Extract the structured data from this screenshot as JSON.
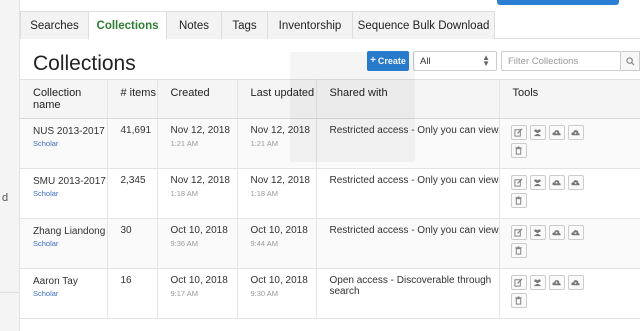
{
  "left_fragment": "d",
  "tabs": [
    {
      "label": "Searches",
      "active": false
    },
    {
      "label": "Collections",
      "active": true
    },
    {
      "label": "Notes",
      "active": false
    },
    {
      "label": "Tags",
      "active": false
    },
    {
      "label": "Inventorship",
      "active": false
    },
    {
      "label": "Sequence Bulk Download",
      "active": false
    }
  ],
  "panel": {
    "title": "Collections",
    "create_label": "Create",
    "scope_value": "All",
    "filter_placeholder": "Filter Collections"
  },
  "columns": [
    "Collection name",
    "# items",
    "Created",
    "Last updated",
    "Shared with",
    "Tools"
  ],
  "rows": [
    {
      "name": "NUS 2013-2017",
      "role": "Scholar",
      "items": "41,691",
      "created": "Nov 12, 2018",
      "created_time": "1:21 AM",
      "updated": "Nov 12, 2018",
      "updated_time": "1:21 AM",
      "shared": "Restricted access - Only you can view"
    },
    {
      "name": "SMU 2013-2017",
      "role": "Scholar",
      "items": "2,345",
      "created": "Nov 12, 2018",
      "created_time": "1:18 AM",
      "updated": "Nov 12, 2018",
      "updated_time": "1:18 AM",
      "shared": "Restricted access - Only you can view"
    },
    {
      "name": "Zhang Liandong",
      "role": "Scholar",
      "items": "30",
      "created": "Oct 10, 2018",
      "created_time": "9:36 AM",
      "updated": "Oct 10, 2018",
      "updated_time": "9:44 AM",
      "shared": "Restricted access - Only you can view"
    },
    {
      "name": "Aaron Tay",
      "role": "Scholar",
      "items": "16",
      "created": "Oct 10, 2018",
      "created_time": "9:17 AM",
      "updated": "Oct 10, 2018",
      "updated_time": "9:30 AM",
      "shared": "Open access - Discoverable through search"
    }
  ],
  "tools": [
    "edit-icon",
    "users-icon",
    "cloud-upload-icon",
    "cloud-download-icon",
    "trash-icon"
  ],
  "colors": {
    "accent": "#2a7fd4",
    "active_tab": "#2e7d32",
    "role_link": "#3b6fc4"
  }
}
